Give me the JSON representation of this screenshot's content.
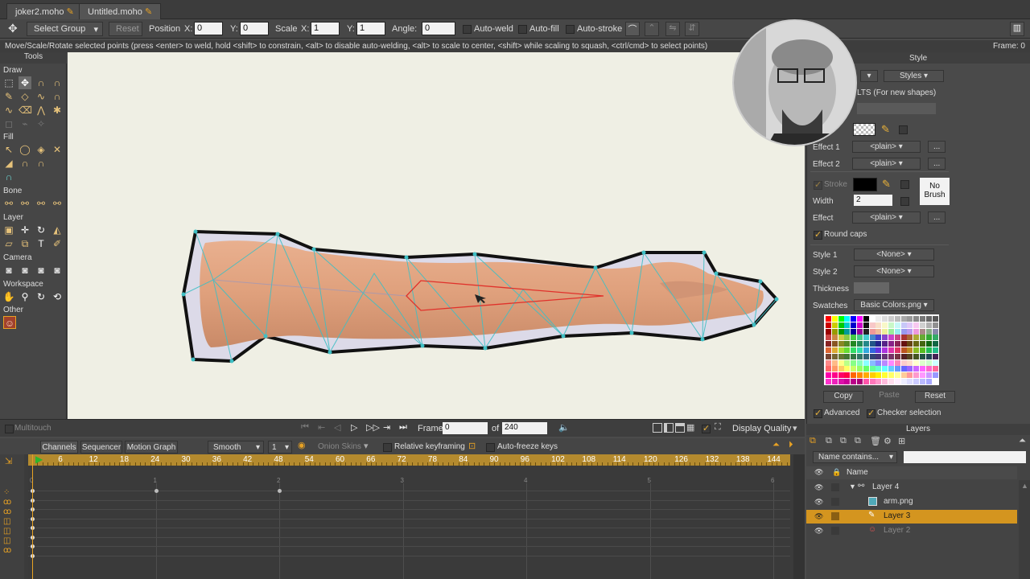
{
  "tabs": [
    {
      "label": "joker2.moho"
    },
    {
      "label": "Untitled.moho"
    }
  ],
  "toolbar": {
    "tool_select": "Select Group",
    "reset": "Reset",
    "position": "Position",
    "x_label": "X:",
    "y_label": "Y:",
    "pos_x": "0",
    "pos_y": "0",
    "scale": "Scale",
    "scale_x": "1",
    "scale_y": "1",
    "angle": "Angle:",
    "angle_val": "0",
    "auto_weld": "Auto-weld",
    "auto_fill": "Auto-fill",
    "auto_stroke": "Auto-stroke"
  },
  "status": {
    "text": "Move/Scale/Rotate selected points (press <enter> to weld, hold <shift> to constrain, <alt> to disable auto-welding, <alt> to scale to center, <shift> while scaling to squash, <ctrl/cmd> to select points)",
    "frame": "Frame: 0"
  },
  "tools": {
    "title": "Tools",
    "sections": {
      "draw": "Draw",
      "fill": "Fill",
      "bone": "Bone",
      "layer": "Layer",
      "camera": "Camera",
      "workspace": "Workspace",
      "other": "Other"
    }
  },
  "style_panel": {
    "title": "Style",
    "styles_btn": "Styles",
    "defaults_text": "LTS (For new shapes)",
    "effect1": "Effect 1",
    "effect1_val": "<plain>",
    "effect2": "Effect 2",
    "effect2_val": "<plain>",
    "stroke": "Stroke",
    "width": "Width",
    "width_val": "2",
    "effect": "Effect",
    "effect_val": "<plain>",
    "no_brush": "No\nBrush",
    "round_caps": "Round caps",
    "style1": "Style 1",
    "style1_val": "<None>",
    "style2": "Style 2",
    "style2_val": "<None>",
    "thickness": "Thickness",
    "swatches": "Swatches",
    "swatches_val": "Basic Colors.png",
    "copy": "Copy",
    "paste": "Paste",
    "reset": "Reset",
    "advanced": "Advanced",
    "checker": "Checker selection"
  },
  "playback": {
    "multitouch": "Multitouch",
    "frame_label": "Frame",
    "frame_val": "0",
    "of": "of",
    "total": "240",
    "display_quality": "Display Quality"
  },
  "timeline": {
    "tabs": [
      "Channels",
      "Sequencer",
      "Motion Graph"
    ],
    "interp": "Smooth",
    "interp_n": "1",
    "onion": "Onion Skins",
    "relative": "Relative keyframing",
    "autofreeze": "Auto-freeze keys",
    "ticks": [
      "6",
      "12",
      "18",
      "24",
      "30",
      "36",
      "42",
      "48",
      "54",
      "60",
      "66",
      "72",
      "78",
      "84",
      "90",
      "96",
      "102",
      "108",
      "114",
      "120",
      "126",
      "132",
      "138",
      "144"
    ],
    "sub_ticks": [
      "0",
      "1",
      "2",
      "3",
      "4",
      "5",
      "6"
    ]
  },
  "layers": {
    "title": "Layers",
    "filter": "Name contains...",
    "col_name": "Name",
    "items": [
      {
        "name": "Layer 4"
      },
      {
        "name": "arm.png"
      },
      {
        "name": "Layer 3"
      },
      {
        "name": "Layer 2"
      }
    ]
  },
  "colors": {
    "accent": "#e8a224",
    "selected_row": "#d4951f",
    "canvas": "#efefe4"
  }
}
